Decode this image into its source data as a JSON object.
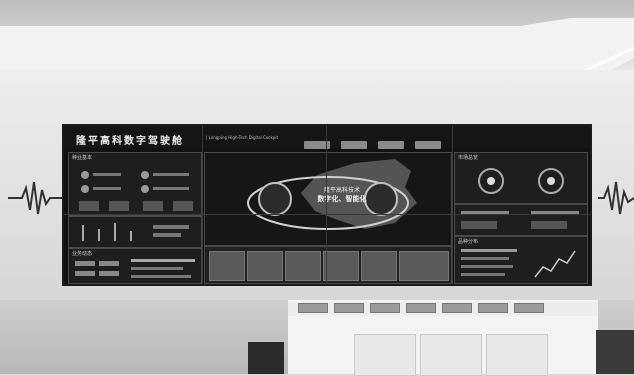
{
  "screen": {
    "title": "隆平高科数字驾驶舱",
    "subtitle": "| Longping High-Tech Digital Cockpit",
    "center_caption_line1": "隆平高科技术",
    "center_caption_line2": "数字化、智能化",
    "panel_titles": {
      "left_top": "种业基本",
      "left_bottom": "业务动态",
      "right_top": "市场总览",
      "right_bottom": "品种分布"
    }
  }
}
